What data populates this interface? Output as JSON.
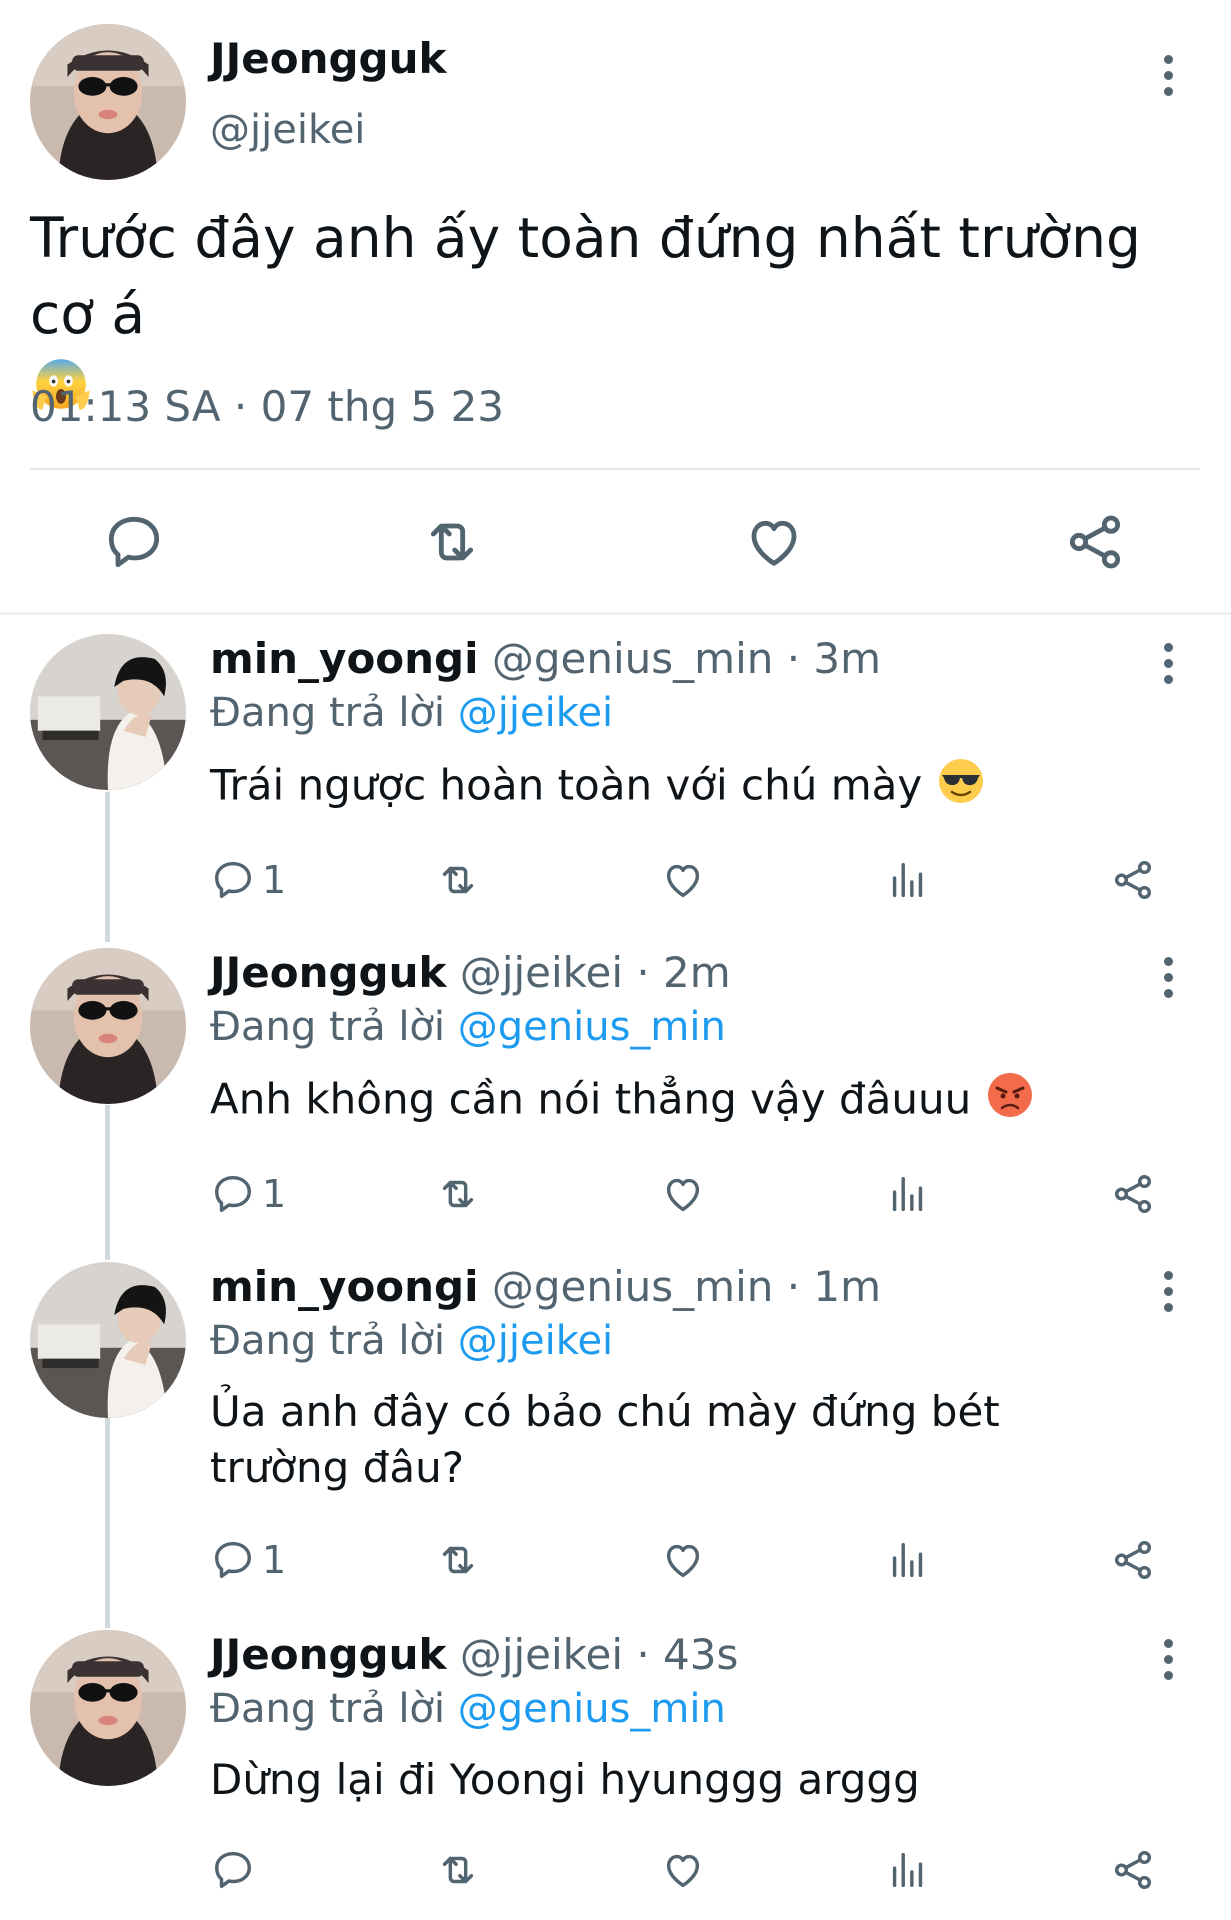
{
  "main_tweet": {
    "name": "JJeongguk",
    "handle": "@jjeikei",
    "text": "Trước đây anh ấy toàn đứng nhất trường cơ á",
    "emoji": "scream-emoji",
    "timestamp": "01:13 SA · 07 thg 5 23"
  },
  "replies": [
    {
      "name": "min_yoongi",
      "meta": "@genius_min · 3m",
      "replying_label": "Đang trả lời",
      "replying_to": "@jjeikei",
      "text": "Trái ngược hoàn toàn với chú mày",
      "emoji": "sunglasses-emoji",
      "reply_count": "1"
    },
    {
      "name": "JJeongguk",
      "meta": "@jjeikei · 2m",
      "replying_label": "Đang trả lời",
      "replying_to": "@genius_min",
      "text": "Anh không cần nói thẳng vậy đâuuu",
      "emoji": "angry-emoji",
      "reply_count": "1"
    },
    {
      "name": "min_yoongi",
      "meta": "@genius_min · 1m",
      "replying_label": "Đang trả lời",
      "replying_to": "@jjeikei",
      "text": "Ủa anh đây có bảo chú mày đứng bét trường đâu?",
      "emoji": "",
      "reply_count": "1"
    },
    {
      "name": "JJeongguk",
      "meta": "@jjeikei · 43s",
      "replying_label": "Đang trả lời",
      "replying_to": "@genius_min",
      "text": "Dừng lại đi Yoongi hyunggg arggg",
      "emoji": "",
      "reply_count": ""
    }
  ],
  "colors": {
    "accent": "#1d9bf0",
    "secondary_text": "#536471",
    "primary_text": "#0f1419"
  }
}
